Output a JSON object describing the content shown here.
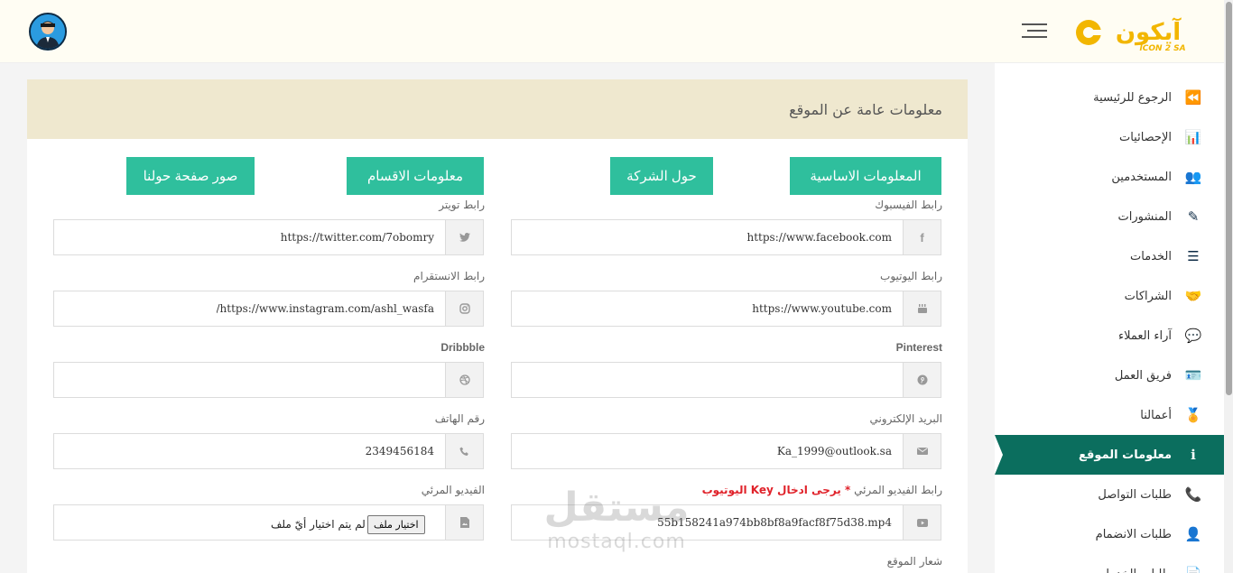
{
  "header": {
    "logo_text": "أيكون",
    "logo_subtext": "ICON 2 SA"
  },
  "sidebar": {
    "items": [
      {
        "label": "الرجوع للرئيسية",
        "icon": "fast-backward-icon",
        "glyph": "⏪"
      },
      {
        "label": "الإحصائيات",
        "icon": "bar-chart-icon",
        "glyph": "📊"
      },
      {
        "label": "المستخدمين",
        "icon": "users-icon",
        "glyph": "👥"
      },
      {
        "label": "المنشورات",
        "icon": "edit-icon",
        "glyph": "✎"
      },
      {
        "label": "الخدمات",
        "icon": "list-icon",
        "glyph": "☰"
      },
      {
        "label": "الشراكات",
        "icon": "handshake-icon",
        "glyph": "🤝"
      },
      {
        "label": "آراء العملاء",
        "icon": "comment-icon",
        "glyph": "💬"
      },
      {
        "label": "فريق العمل",
        "icon": "id-badge-icon",
        "glyph": "🪪"
      },
      {
        "label": "أعمالنا",
        "icon": "award-icon",
        "glyph": "🏅"
      },
      {
        "label": "معلومات الموقع",
        "icon": "info-icon",
        "glyph": "ℹ",
        "active": true
      },
      {
        "label": "طلبات التواصل",
        "icon": "phone-icon",
        "glyph": "📞"
      },
      {
        "label": "طلبات الانضمام",
        "icon": "user-icon",
        "glyph": "👤"
      },
      {
        "label": "طلبات الخدمات",
        "icon": "file-icon",
        "glyph": "📄"
      }
    ]
  },
  "main": {
    "title": "معلومات عامة عن الموقع",
    "tabs": {
      "basic": "المعلومات الاساسية",
      "about": "حول الشركة",
      "sections": "معلومات الاقسام",
      "gallery": "صور صفحة حولنا"
    },
    "fields": {
      "facebook": {
        "label": "رابط الفيسبوك",
        "value": "https://www.facebook.com"
      },
      "twitter": {
        "label": "رابط تويتر",
        "value": "https://twitter.com/7obomry"
      },
      "youtube": {
        "label": "رابط اليوتيوب",
        "value": "https://www.youtube.com"
      },
      "instagram": {
        "label": "رابط الانستقرام",
        "value": "https://www.instagram.com/ashl_wasfa/"
      },
      "pinterest": {
        "label": "Pinterest",
        "value": ""
      },
      "dribbble": {
        "label": "Dribbble",
        "value": ""
      },
      "email": {
        "label": "البريد الإلكتروني",
        "value": "Ka_1999@outlook.sa"
      },
      "phone": {
        "label": "رقم الهاتف",
        "value": "2349456184"
      },
      "video_link": {
        "label": "رابط الفيديو المرئي",
        "note": "* يرجى ادخال Key اليوتيوب",
        "value": "55b158241a974bb8bf8a9facf8f75d38.mp4"
      },
      "video_file": {
        "label": "الفيديو المرئي",
        "button": "اختيار ملف",
        "status": "لم يتم اختيار أيّ ملف"
      },
      "logo": {
        "label": "شعار الموقع"
      }
    }
  },
  "watermark": {
    "ar": "مستقل",
    "en": "mostaql.com"
  },
  "colors": {
    "accent": "#2fbf9d",
    "sidebar_active": "#0b6e5e",
    "card_header": "#efe8cf"
  }
}
